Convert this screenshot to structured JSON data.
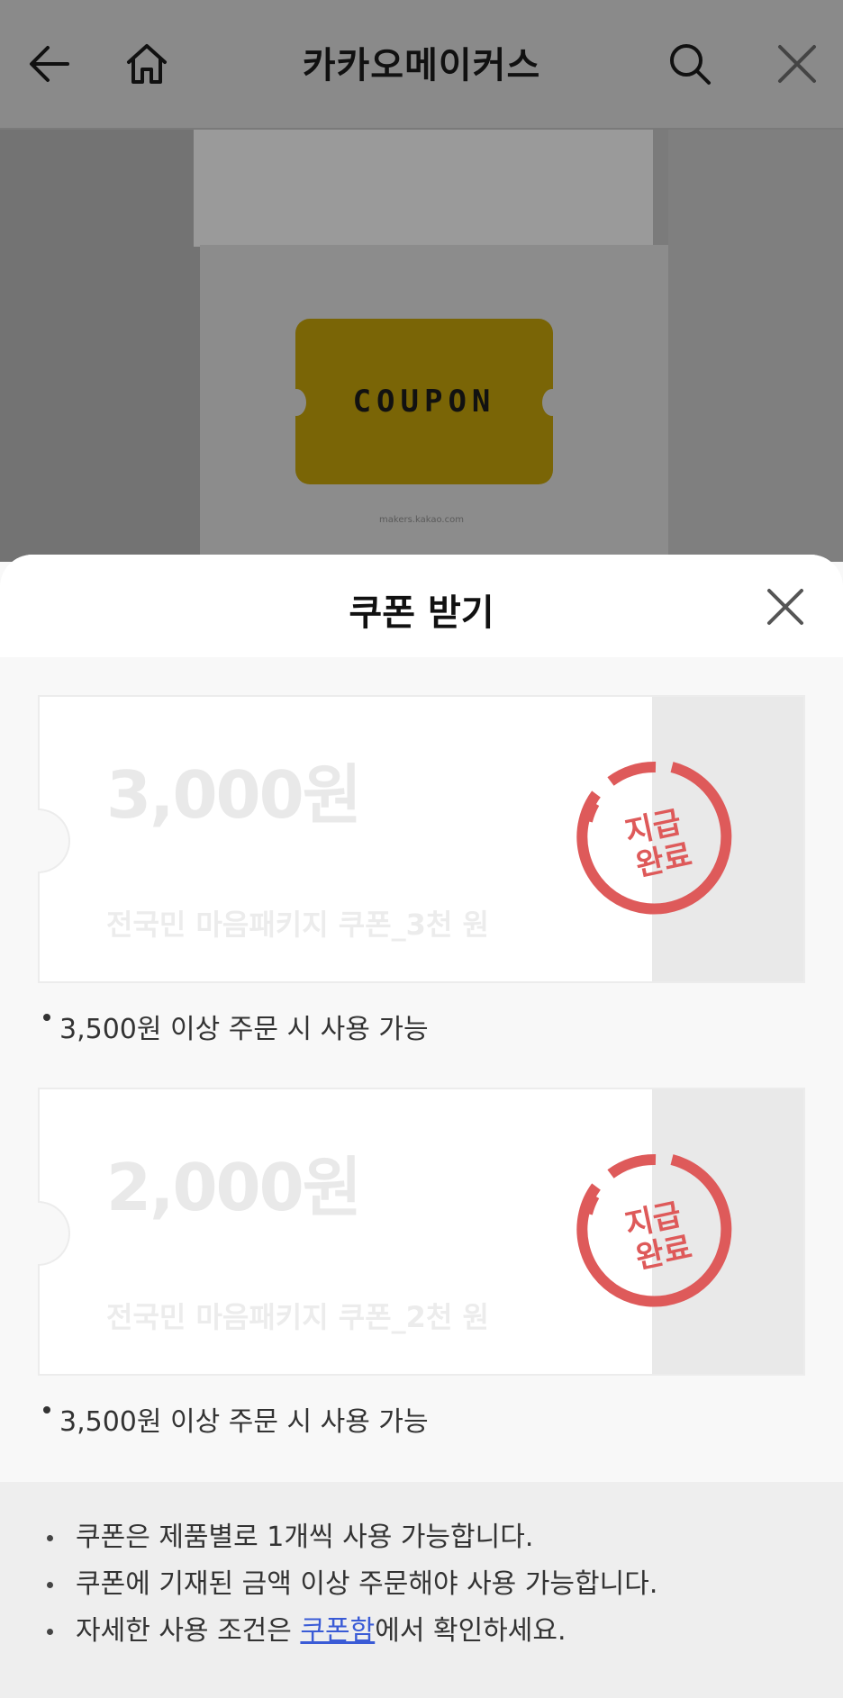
{
  "header": {
    "title": "카카오메이커스",
    "back_icon": "arrow-left-icon",
    "home_icon": "home-icon",
    "search_icon": "search-icon",
    "close_icon": "close-icon"
  },
  "hero": {
    "card_text": "COUPON",
    "footer_text": "makers.kakao.com",
    "card_color": "#7a6506"
  },
  "sheet": {
    "title": "쿠폰 받기",
    "coupons": [
      {
        "amount": "3,000원",
        "name": "전국민 마음패키지 쿠폰_3천 원",
        "stamp_line1": "지급",
        "stamp_line2": "완료",
        "condition": "3,500원 이상 주문 시 사용 가능"
      },
      {
        "amount": "2,000원",
        "name": "전국민 마음패키지 쿠폰_2천 원",
        "stamp_line1": "지급",
        "stamp_line2": "완료",
        "condition": "3,500원 이상 주문 시 사용 가능"
      }
    ],
    "notices": [
      "쿠폰은 제품별로 1개씩 사용 가능합니다.",
      "쿠폰에 기재된 금액 이상 주문해야 사용 가능합니다."
    ],
    "notice3_prefix": "자세한 사용 조건은 ",
    "notice3_link": "쿠폰함",
    "notice3_suffix": "에서 확인하세요."
  },
  "colors": {
    "stamp": "#de5a5a",
    "link": "#3a5bd6"
  }
}
